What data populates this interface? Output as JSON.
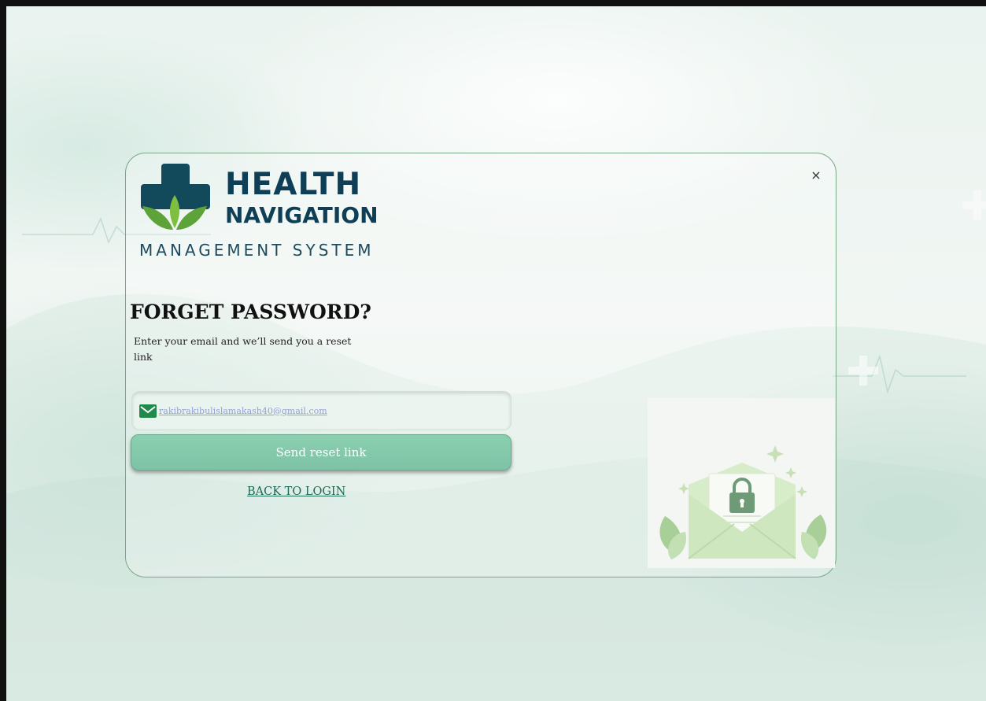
{
  "brand": {
    "line1": "HEALTH",
    "line2": "NAVIGATION",
    "line3": "MANAGEMENT SYSTEM",
    "colors": {
      "navy": "#0f3f57",
      "green": "#5a9e3a",
      "accent": "#7ec3a5"
    }
  },
  "dialog": {
    "close_icon": "×",
    "title": "FORGET PASSWORD?",
    "subtitle": "Enter your email and we’ll send you a reset link",
    "email": {
      "icon": "mail-icon",
      "value": "rakibrakibulislamakash40@gmail.com"
    },
    "send_button_label": "Send reset link",
    "back_link_label": "BACK TO LOGIN"
  },
  "illustration": {
    "icon": "envelope-lock-icon"
  }
}
